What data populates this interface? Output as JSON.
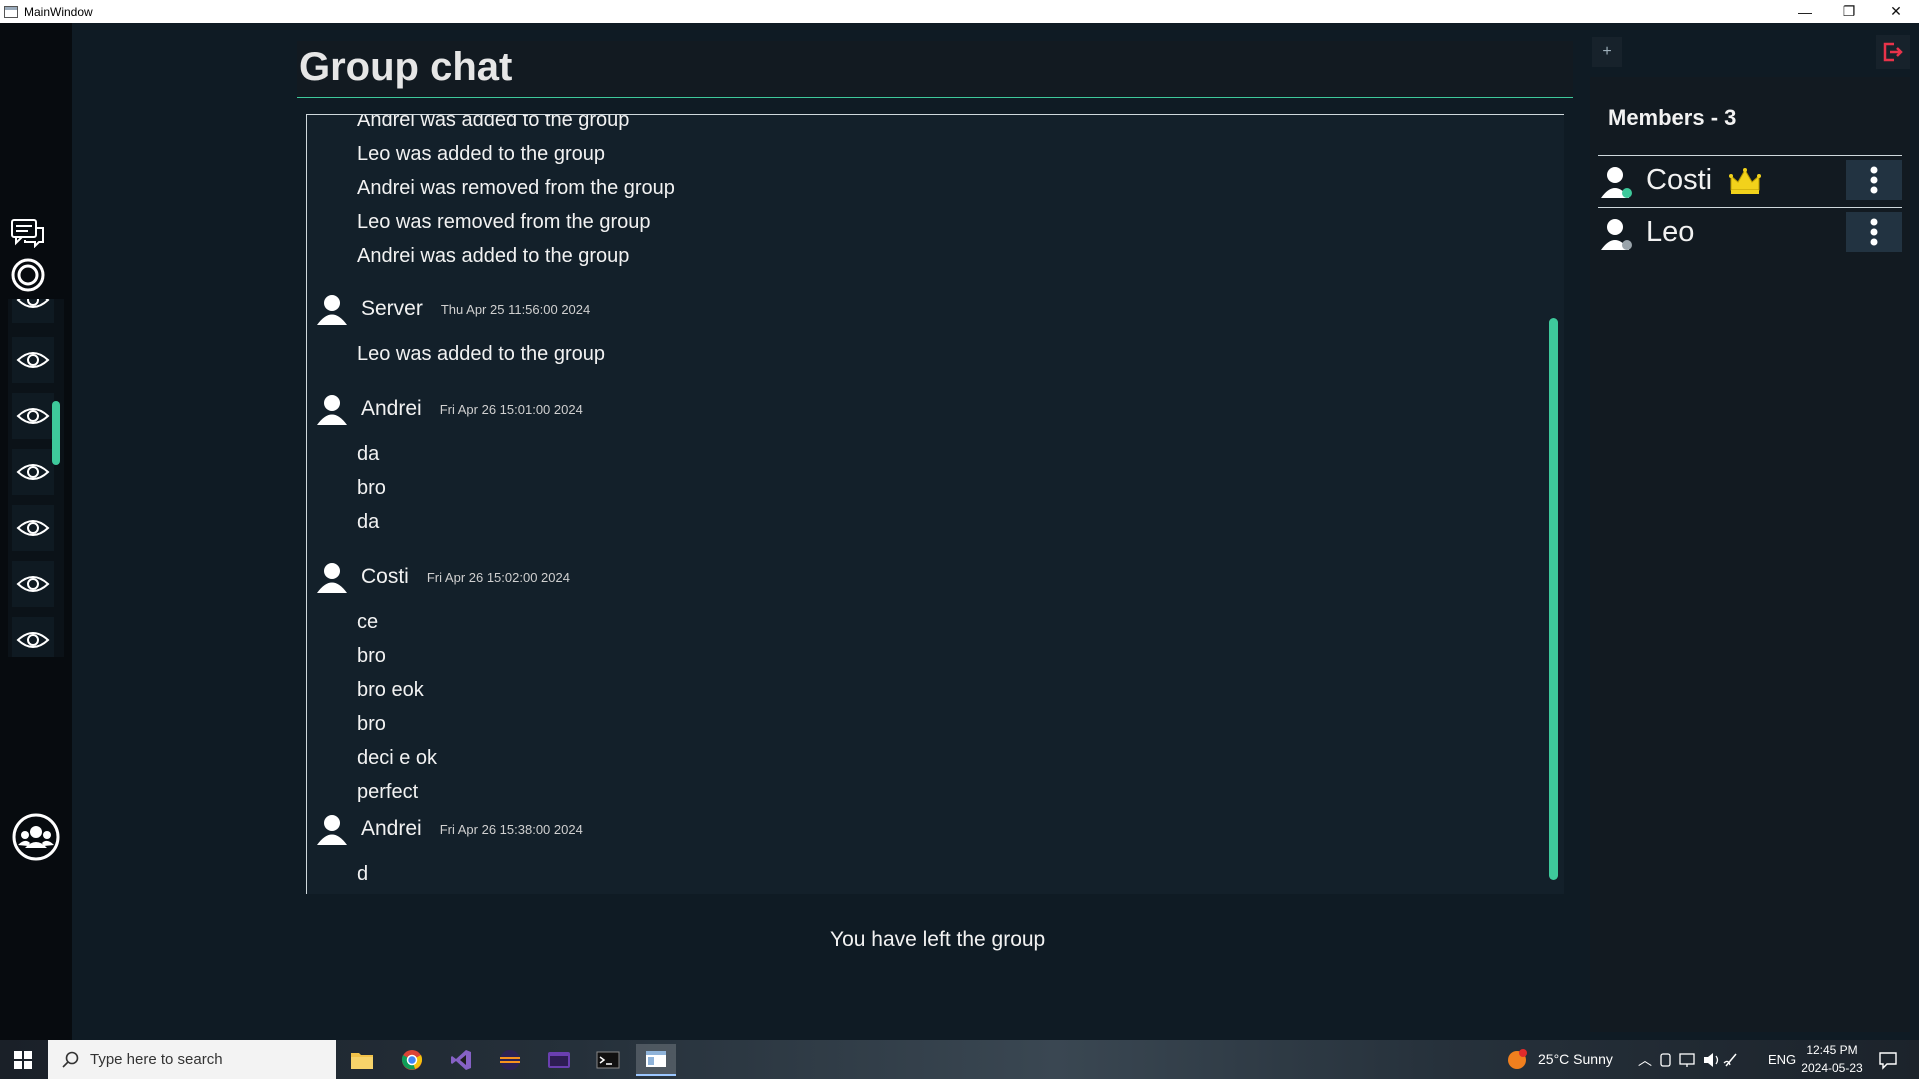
{
  "window": {
    "title": "MainWindow",
    "minimize_glyph": "—",
    "restore_glyph": "❐",
    "close_glyph": "✕"
  },
  "header": {
    "title": "Group chat"
  },
  "chat": {
    "system_lines_top": [
      "Andrei was added to the group",
      "Leo was added to the group",
      "Andrei was removed from the group",
      "Leo was removed from the group",
      "Andrei was added to the group"
    ],
    "messages": [
      {
        "author": "Server",
        "time": "Thu Apr 25 11:56:00 2024",
        "lines": [
          "Leo was added to the group"
        ]
      },
      {
        "author": "Andrei",
        "time": "Fri Apr 26 15:01:00 2024",
        "lines": [
          "da",
          "bro",
          "da"
        ]
      },
      {
        "author": "Costi",
        "time": "Fri Apr 26 15:02:00 2024",
        "lines": [
          "ce",
          "bro",
          "bro eok",
          "bro",
          "deci e ok",
          "perfect"
        ]
      },
      {
        "author": "Andrei",
        "time": "Fri Apr 26 15:38:00 2024",
        "lines": [
          "d"
        ]
      }
    ],
    "status": "You have left the group"
  },
  "members_panel": {
    "add_label": "+",
    "title": "Members - 3",
    "members": [
      {
        "name": "Costi",
        "online": true,
        "owner": true
      },
      {
        "name": "Leo",
        "online": false,
        "owner": false
      }
    ]
  },
  "colors": {
    "accent": "#3ec99b",
    "online": "#3ec99b",
    "offline": "#9aa4ab",
    "leave_icon": "#e8334a",
    "crown": "#f2d21b"
  },
  "taskbar": {
    "search_placeholder": "Type here to search",
    "weather": "25°C  Sunny",
    "language": "ENG",
    "time": "12:45 PM",
    "date": "2024-05-23"
  }
}
